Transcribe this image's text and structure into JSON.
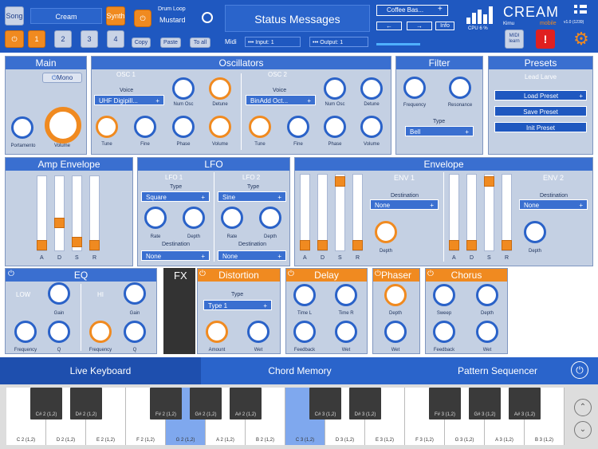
{
  "top": {
    "song": "Song",
    "preset_name": "Cream",
    "synth": "Synth",
    "slots": [
      "1",
      "2",
      "3",
      "4"
    ],
    "drum_label": "Drum Loop",
    "drum_value": "Mustard",
    "copy": "Copy",
    "paste": "Paste",
    "to_all": "To all",
    "status": "Status Messages",
    "midi": "Midi",
    "input": "••• Input: 1",
    "output": "••• Output: 1",
    "coffee": "Coffee Bas...",
    "info": "Info",
    "cpu": "CPU 6 %",
    "brand": "CREAM",
    "brand_sub": "mobile",
    "kirnu": "Kirnu",
    "version": "v1.0 (1239)",
    "midi_learn": "MIDI learn",
    "colors": {
      "accent": "#1f58c0",
      "orange": "#f08a20",
      "alert": "#e02020"
    }
  },
  "main": {
    "title": "Main",
    "mono": "Mono",
    "knobs": [
      {
        "label": "Portamento",
        "min": "0",
        "max": "100"
      },
      {
        "label": "Volume"
      }
    ]
  },
  "osc": {
    "title": "Oscillators",
    "osc1": {
      "name": "OSC 1",
      "voice_label": "Voice",
      "voice": "UHF Digipill...",
      "num_osc": "Num Osc",
      "num_min": "1",
      "num_max": "7",
      "detune": "Detune",
      "tune": "Tune",
      "tmin": "-24",
      "tmax": "24",
      "fine": "Fine",
      "fmin": "-100",
      "fmax": "100",
      "phase": "Phase",
      "volume": "Volume",
      "min0": "0",
      "max100": "100"
    },
    "osc2": {
      "name": "OSC 2",
      "voice_label": "Voice",
      "voice": "BinAdd Oct...",
      "num_osc": "Num Osc",
      "detune": "Detune",
      "tune": "Tune",
      "fine": "Fine",
      "phase": "Phase",
      "volume": "Volume"
    }
  },
  "filter": {
    "title": "Filter",
    "frequency": "Frequency",
    "resonance": "Resonance",
    "type_label": "Type",
    "type": "Bell"
  },
  "presets": {
    "title": "Presets",
    "current": "Lead Larve",
    "load": "Load Preset",
    "save": "Save Preset",
    "init": "Init Preset"
  },
  "amp": {
    "title": "Amp Envelope",
    "labels": [
      "A",
      "D",
      "S",
      "R"
    ]
  },
  "lfo": {
    "title": "LFO",
    "lfo1": {
      "name": "LFO 1",
      "type_label": "Type",
      "type": "Square",
      "rate": "Rate",
      "depth": "Depth",
      "dest_label": "Destination",
      "dest": "None"
    },
    "lfo2": {
      "name": "LFO 2",
      "type_label": "Type",
      "type": "Sine",
      "rate": "Rate",
      "depth": "Depth",
      "dest_label": "Destination",
      "dest": "None"
    }
  },
  "env": {
    "title": "Envelope",
    "env1": {
      "name": "ENV 1",
      "dest_label": "Destination",
      "dest": "None",
      "depth": "Depth"
    },
    "env2": {
      "name": "ENV 2",
      "dest_label": "Destination",
      "dest": "None",
      "depth": "Depth"
    },
    "labels": [
      "A",
      "D",
      "S",
      "R"
    ]
  },
  "eq": {
    "title": "EQ",
    "low": "LOW",
    "hi": "HI",
    "gain": "Gain",
    "frequency": "Frequency",
    "q": "Q"
  },
  "fx": {
    "title": "FX"
  },
  "distortion": {
    "title": "Distortion",
    "type_label": "Type",
    "type": "Type 1",
    "amount": "Amount",
    "wet": "Wet"
  },
  "delay": {
    "title": "Delay",
    "time_l": "Time L",
    "time_r": "Time R",
    "feedback": "Feedback",
    "wet": "Wet"
  },
  "phaser": {
    "title": "Phaser",
    "depth": "Depth",
    "wet": "Wet"
  },
  "chorus": {
    "title": "Chorus",
    "sweep": "Sweep",
    "depth": "Depth",
    "feedback": "Feedback",
    "wet": "Wet"
  },
  "tabs": [
    "Live Keyboard",
    "Chord Memory",
    "Pattern Sequencer"
  ],
  "keys": {
    "white": [
      "C 2 (1,2)",
      "D 2 (1,2)",
      "E 2 (1,2)",
      "F 2 (1,2)",
      "G 2 (1,2)",
      "A 2 (1,2)",
      "B 2 (1,2)",
      "C 3 (1,2)",
      "D 3 (1,2)",
      "E 3 (1,2)",
      "F 3 (1,2)",
      "G 3 (1,2)",
      "A 3 (1,2)",
      "B 3 (1,2)"
    ],
    "black": [
      "C# 2 (1,2)",
      "D# 2 (1,2)",
      "F# 2 (1,2)",
      "G# 2 (1,2)",
      "A# 2 (1,2)",
      "C# 3 (1,2)",
      "D# 3 (1,2)",
      "F# 3 (1,2)",
      "G# 3 (1,2)",
      "A# 3 (1,2)"
    ]
  }
}
